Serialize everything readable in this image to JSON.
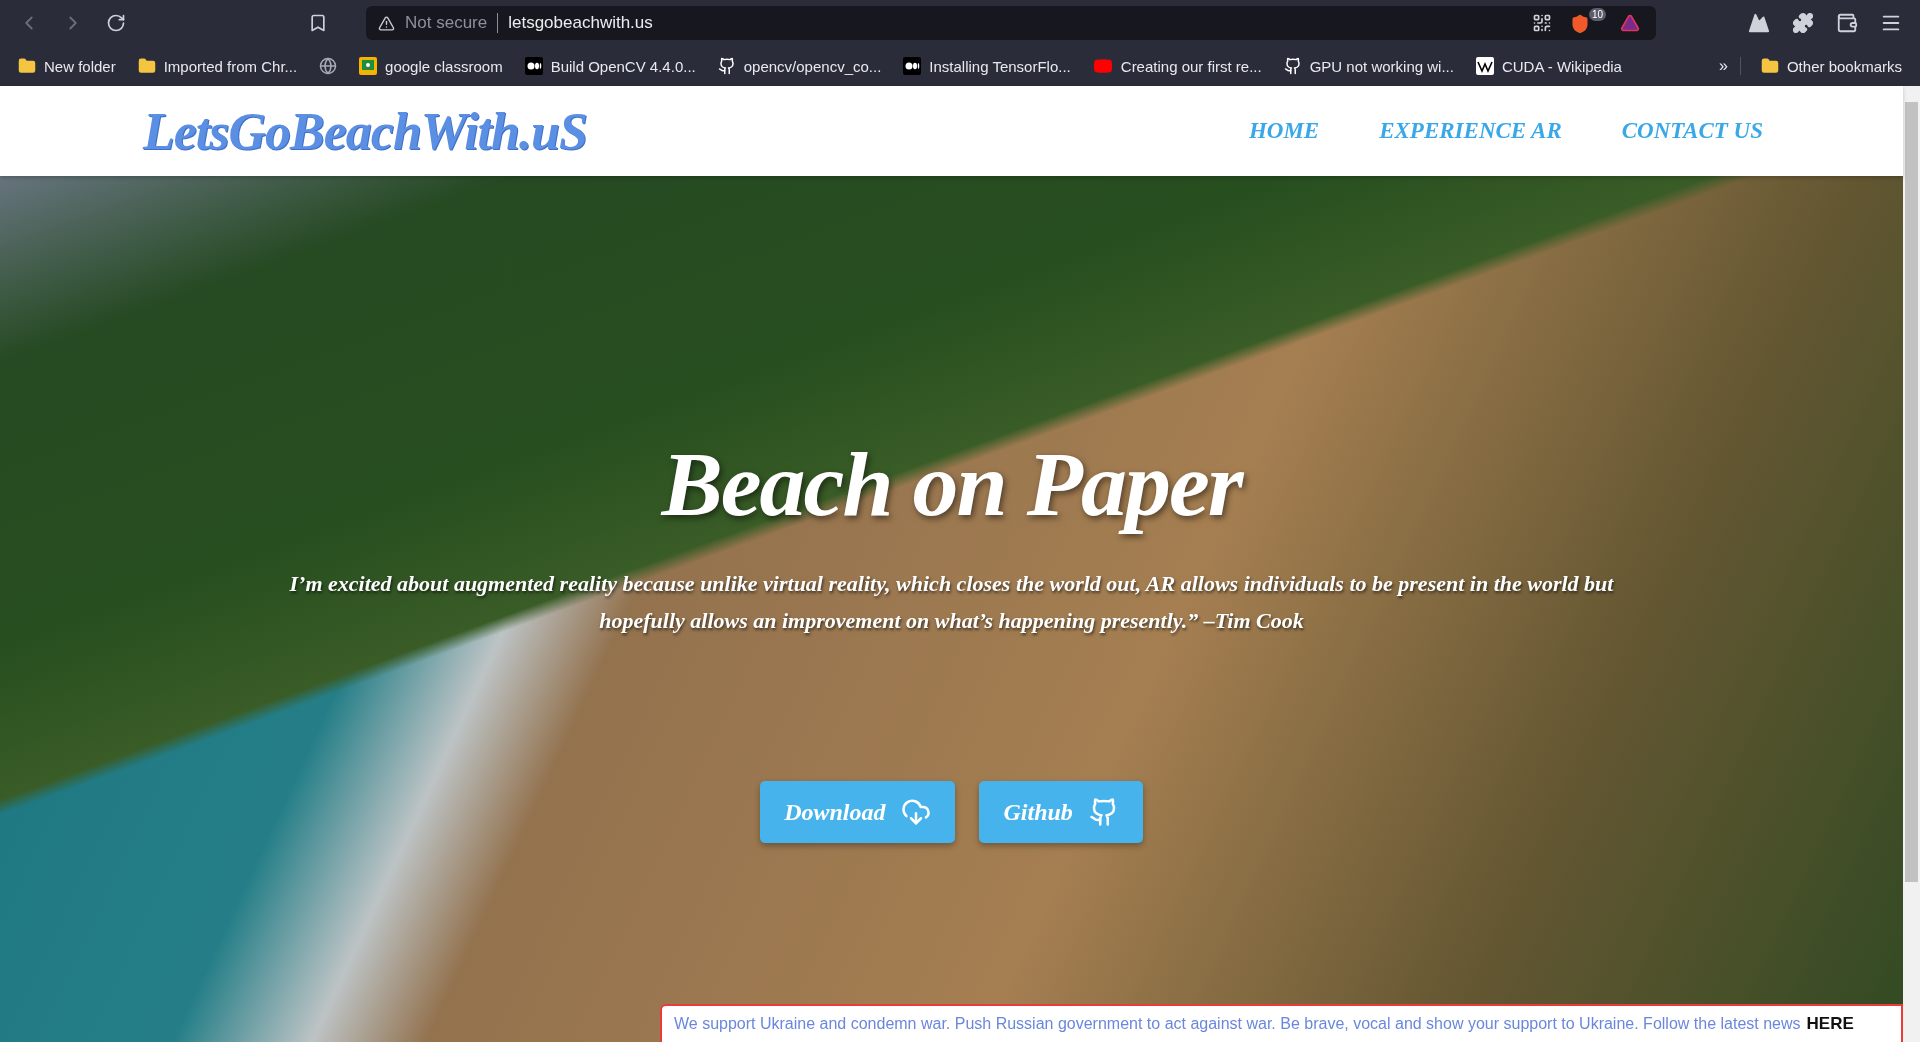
{
  "browser": {
    "address_bar": {
      "security": "Not secure",
      "url": "letsgobeachwith.us"
    },
    "shields_count": "10",
    "bookmarks": [
      {
        "kind": "folder",
        "label": "New folder"
      },
      {
        "kind": "folder",
        "label": "Imported from Chr..."
      },
      {
        "kind": "globe"
      },
      {
        "kind": "classroom",
        "label": "google classroom"
      },
      {
        "kind": "medium",
        "label": "Build OpenCV 4.4.0..."
      },
      {
        "kind": "github",
        "label": "opencv/opencv_co..."
      },
      {
        "kind": "medium",
        "label": "Installing TensorFlo..."
      },
      {
        "kind": "youtube",
        "label": "Creating our first re..."
      },
      {
        "kind": "github",
        "label": "GPU not working wi..."
      },
      {
        "kind": "wiki",
        "label": "CUDA - Wikipedia"
      }
    ],
    "overflow": "»",
    "other_bookmarks": "Other bookmarks"
  },
  "site": {
    "logo": "LetsGoBeachWith.uS",
    "nav": [
      {
        "label": "HOME"
      },
      {
        "label": "EXPERIENCE AR"
      },
      {
        "label": "CONTACT US"
      }
    ]
  },
  "hero": {
    "title": "Beach on Paper",
    "quote": "I’m excited about augmented reality because unlike virtual reality, which closes the world out, AR allows individuals to be present in the world but hopefully allows an improvement on what’s happening presently.” –Tim Cook",
    "buttons": [
      {
        "kind": "download",
        "label": "Download"
      },
      {
        "kind": "github",
        "label": "Github"
      }
    ]
  },
  "banner": {
    "message": "We support Ukraine and condemn war. Push Russian government to act against war. Be brave, vocal and show your support to Ukraine. Follow the latest news",
    "link": "HERE"
  }
}
